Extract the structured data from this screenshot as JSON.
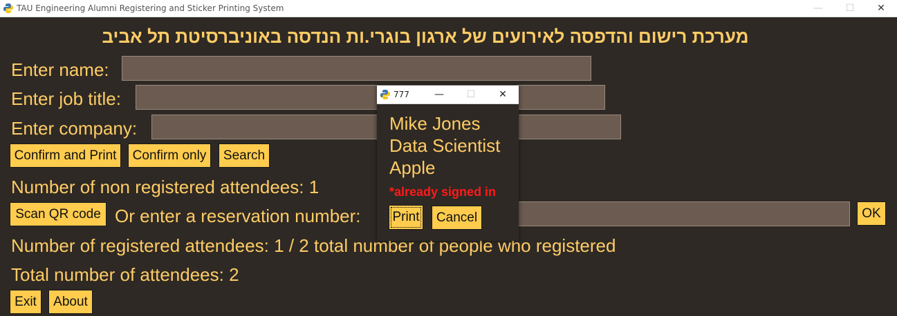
{
  "window": {
    "title": "TAU Engineering Alumni Registering and Sticker Printing System",
    "minimize": "—",
    "maximize": "☐",
    "close": "✕"
  },
  "heading": "מערכת רישום והדפסה לאירועים של ארגון בוגרי.ות הנדסה באוניברסיטת תל אביב",
  "form": {
    "name_label": "Enter name:",
    "name_value": "",
    "job_label": "Enter job title:",
    "job_value": "",
    "company_label": "Enter company:",
    "company_value": ""
  },
  "buttons": {
    "confirm_print": "Confirm and Print",
    "confirm_only": "Confirm only",
    "search": "Search",
    "scan_qr": "Scan QR code",
    "ok": "OK",
    "exit": "Exit",
    "about": "About"
  },
  "stats": {
    "non_registered_label": "Number of non registered attendees:",
    "non_registered_count": "1",
    "reservation_label": "Or enter a reservation number:",
    "reservation_value": "",
    "registered_label": "Number of registered attendees:",
    "registered_count": "1",
    "separator": "/",
    "total_registered": "2",
    "total_registered_suffix": "total number of people who registered",
    "total_label": "Total number of attendees:",
    "total_count": "2"
  },
  "dialog": {
    "title": "777",
    "name": "Mike Jones",
    "job": "Data Scientist",
    "company": "Apple",
    "warning": "*already signed in",
    "print": "Print",
    "cancel": "Cancel",
    "minimize": "—",
    "maximize": "☐",
    "close": "✕"
  },
  "colors": {
    "background": "#2e2924",
    "label": "#ffcc66",
    "button": "#ffcc4d",
    "input": "#6b5b51",
    "warning": "#ff1a1a"
  }
}
